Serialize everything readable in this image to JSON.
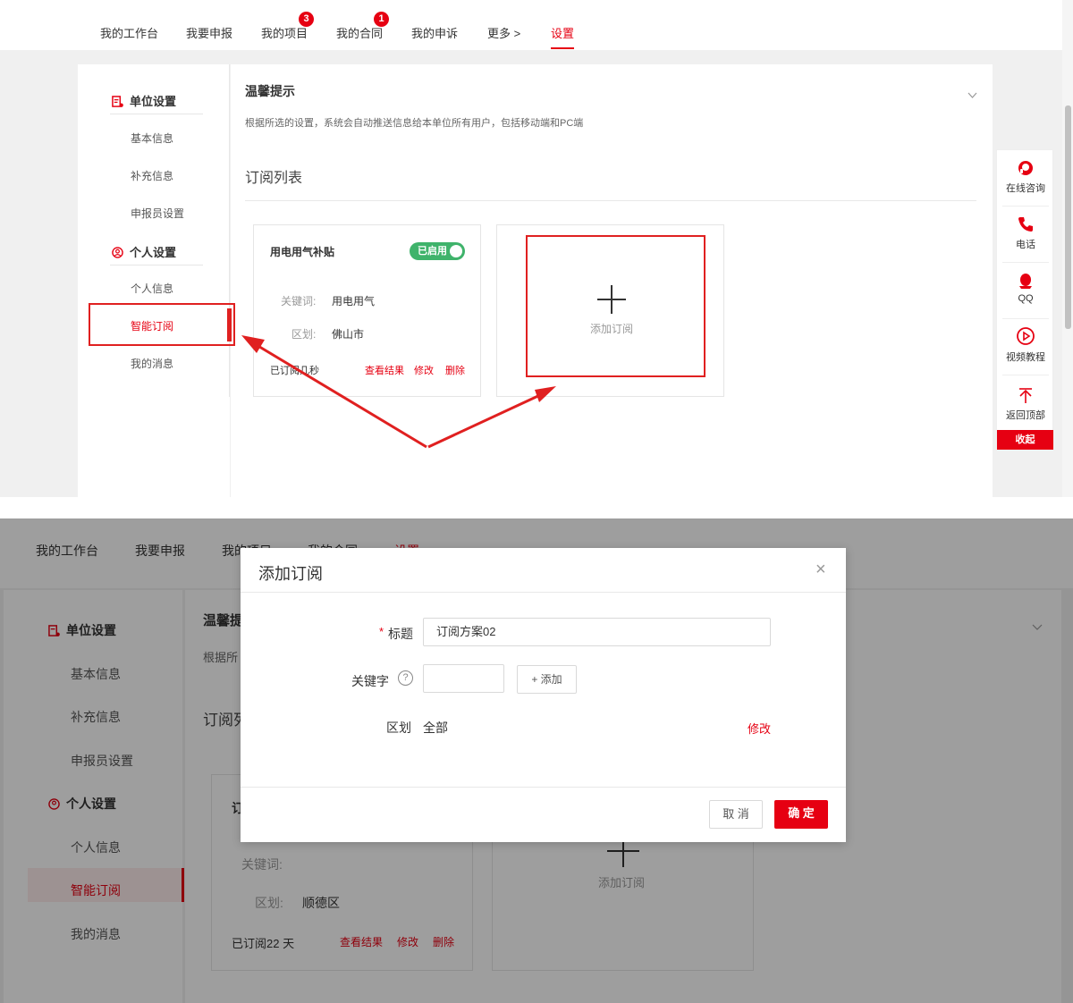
{
  "colors": {
    "accent": "#e60012",
    "toggle_on": "#3fb36b",
    "annotation": "#e02020"
  },
  "nav": {
    "items": [
      "我的工作台",
      "我要申报",
      "我的项目",
      "我的合同",
      "我的申诉",
      "更多 >",
      "设置"
    ],
    "project_badge": "3",
    "contract_badge": "1"
  },
  "sidebar": {
    "unit_section": "单位设置",
    "unit_items": [
      "基本信息",
      "补充信息",
      "申报员设置"
    ],
    "personal_section": "个人设置",
    "personal_items": [
      "个人信息",
      "智能订阅",
      "我的消息"
    ]
  },
  "notice": {
    "title": "温馨提示",
    "text": "根据所选的设置，系统会自动推送信息给本单位所有用户，包括移动端和PC端",
    "toggle_icon": "chevron-down-icon"
  },
  "subscriptions": {
    "heading": "订阅列表",
    "card": {
      "title": "用电用气补贴",
      "toggle_label": "已启用",
      "keyword_label": "关键词:",
      "keyword_value": "用电用气",
      "district_label": "区划:",
      "district_value": "佛山市",
      "subscribed_text": "已订阅几秒",
      "actions": [
        "查看结果",
        "修改",
        "删除"
      ]
    },
    "add_card": {
      "plus": "+",
      "label": "添加订阅"
    }
  },
  "float_bar": {
    "items": [
      "在线咨询",
      "电话",
      "QQ",
      "视频教程",
      "返回顶部"
    ],
    "collapse": "收起"
  },
  "bottom": {
    "nav_items": [
      "我的工作台",
      "我要申报",
      "我的项目",
      "我的合同",
      "设置"
    ],
    "notice_partial": "温馨提",
    "notice_text_partial": "根据所",
    "heading_partial": "订阅列",
    "card_title_partial": "订",
    "keyword_label": "关键词:",
    "district_label": "区划:",
    "district_value": "顺德区",
    "subscribed_text": "已订阅22 天",
    "actions": [
      "查看结果",
      "修改",
      "删除"
    ],
    "add_label": "添加订阅"
  },
  "modal": {
    "title": "添加订阅",
    "close": "×",
    "required_mark": "*",
    "title_label": "标题",
    "title_value": "订阅方案02",
    "keyword_label": "关键字",
    "keyword_help": "?",
    "add_button": "+ 添加",
    "district_label": "区划",
    "district_value": "全部",
    "modify_link": "修改",
    "cancel": "取 消",
    "confirm": "确 定"
  }
}
